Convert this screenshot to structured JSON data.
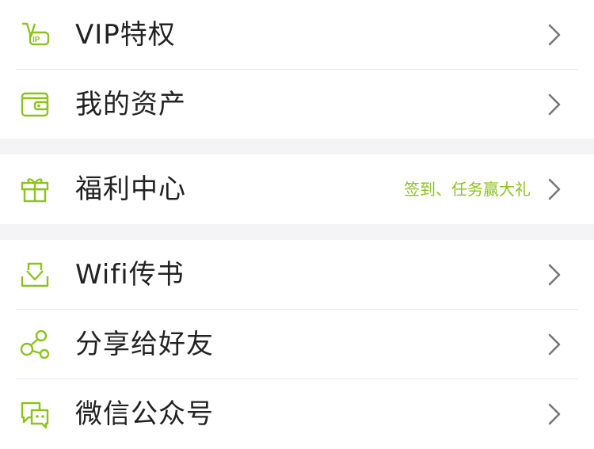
{
  "menu": {
    "group1": [
      {
        "label": "VIP特权",
        "icon": "vip-icon"
      },
      {
        "label": "我的资产",
        "icon": "wallet-icon"
      }
    ],
    "group2": [
      {
        "label": "福利中心",
        "hint": "签到、任务赢大礼",
        "icon": "gift-icon"
      }
    ],
    "group3": [
      {
        "label": "Wifi传书",
        "icon": "download-tray-icon"
      },
      {
        "label": "分享给好友",
        "icon": "share-icon"
      },
      {
        "label": "微信公众号",
        "icon": "wechat-icon"
      }
    ]
  },
  "colors": {
    "accent": "#8dc21f",
    "text": "#222222",
    "chevron": "#777777",
    "background": "#f4f3f6"
  }
}
